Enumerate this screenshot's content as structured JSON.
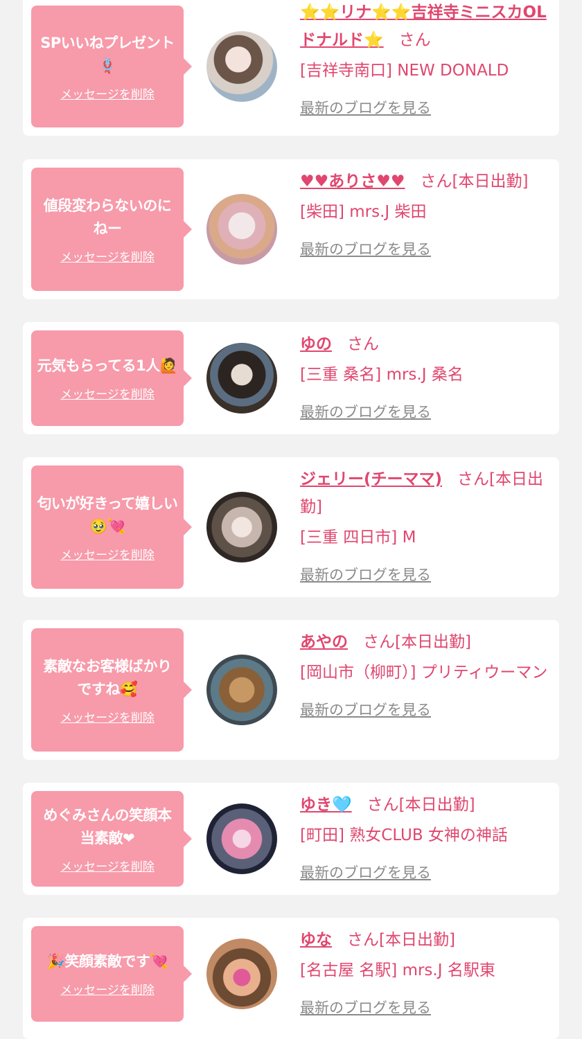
{
  "delete_label": "メッセージを削除",
  "blog_label": "最新のブログを見る",
  "cards": [
    {
      "message": "SPいいねプレゼント🪢",
      "name": "⭐⭐リナ⭐⭐吉祥寺ミニスカOLドナルド⭐",
      "suffix": "さん",
      "shop": "[吉祥寺南口] NEW DONALD"
    },
    {
      "message": "値段変わらないのにねー",
      "name": "♥♥ありさ♥♥",
      "suffix": "さん[本日出勤]",
      "shop": "[柴田] mrs.J 柴田"
    },
    {
      "message": "元気もらってる1人🙋",
      "name": "ゆの",
      "suffix": "さん",
      "shop": "[三重 桑名] mrs.J 桑名"
    },
    {
      "message": "匂いが好きって嬉しい🥹💘",
      "name": "ジェリー(チーママ)",
      "suffix": "さん[本日出勤]",
      "shop": "[三重 四日市] M"
    },
    {
      "message": "素敵なお客様ばかりですね🥰",
      "name": "あやの",
      "suffix": "さん[本日出勤]",
      "shop": "[岡山市（柳町）] プリティウーマン"
    },
    {
      "message": "めぐみさんの笑顔本当素敵❤",
      "name": "ゆき🩵",
      "suffix": "さん[本日出勤]",
      "shop": "[町田] 熟女CLUB 女神の神話"
    },
    {
      "message": "🎉笑顔素敵です💘",
      "name": "ゆな",
      "suffix": "さん[本日出勤]",
      "shop": "[名古屋 名駅] mrs.J 名駅東"
    }
  ],
  "colors": {
    "accent": "#e0466e",
    "bubble": "#f79aaa",
    "background": "#f2f2f2"
  }
}
